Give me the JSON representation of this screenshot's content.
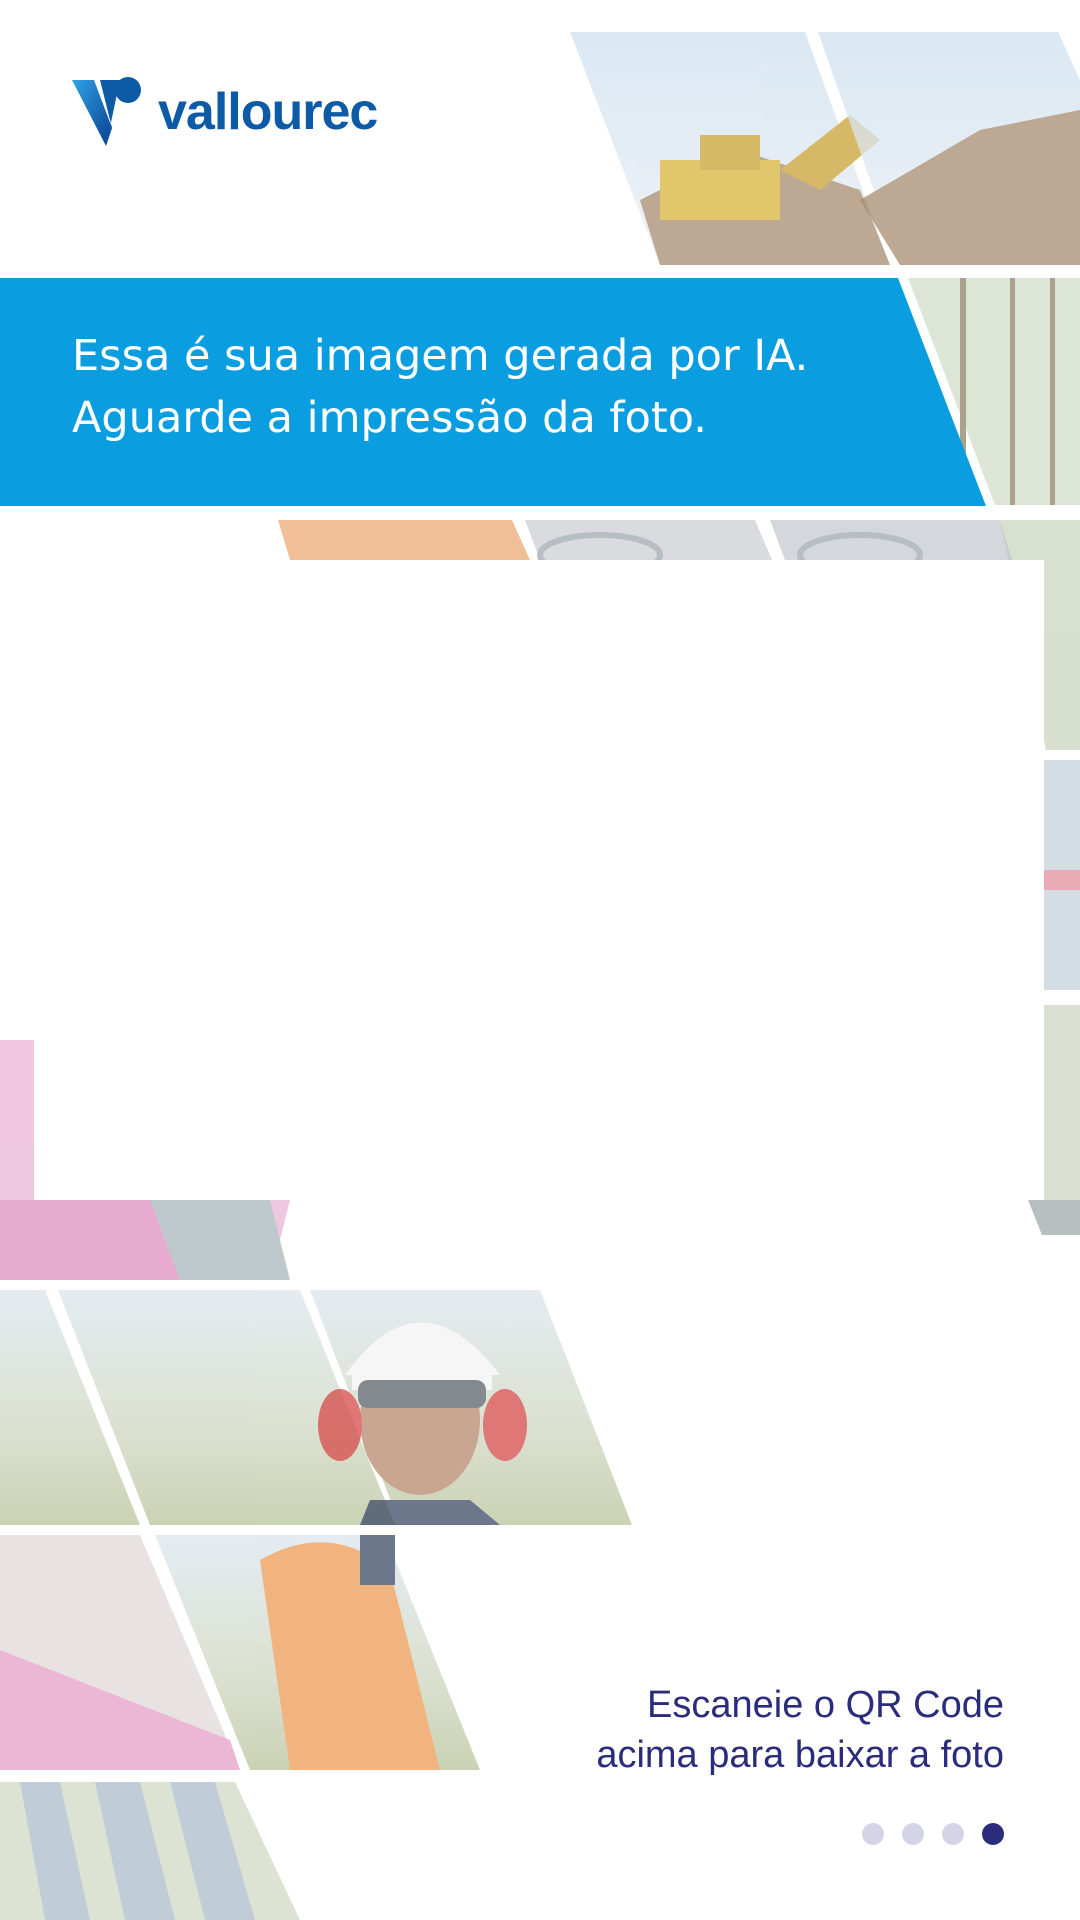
{
  "brand": {
    "name": "vallourec",
    "color": "#0d5aa7"
  },
  "banner": {
    "line1": "Essa é sua imagem gerada por IA.",
    "line2": "Aguarde a impressão da foto.",
    "color": "#0a9ee0"
  },
  "qr_caption": {
    "line1": "Escaneie o QR Code",
    "line2": "acima para baixar a foto",
    "color": "#2b2d7c"
  },
  "pager": {
    "total": 4,
    "active_index": 3
  },
  "collage_tiles": [
    {
      "name": "tile-bulldozer",
      "subject": "wheel loader on gravel pile"
    },
    {
      "name": "tile-forest",
      "subject": "eucalyptus forest"
    },
    {
      "name": "tile-pipes",
      "subject": "steel pipe ends"
    },
    {
      "name": "tile-offshore",
      "subject": "offshore platform"
    },
    {
      "name": "tile-pink-pipe",
      "subject": "pink pipe detail"
    },
    {
      "name": "tile-worker-helmet",
      "subject": "worker with helmet and goggles"
    },
    {
      "name": "tile-worker-orange",
      "subject": "worker in orange uniform"
    },
    {
      "name": "tile-solar",
      "subject": "solar panels"
    }
  ]
}
